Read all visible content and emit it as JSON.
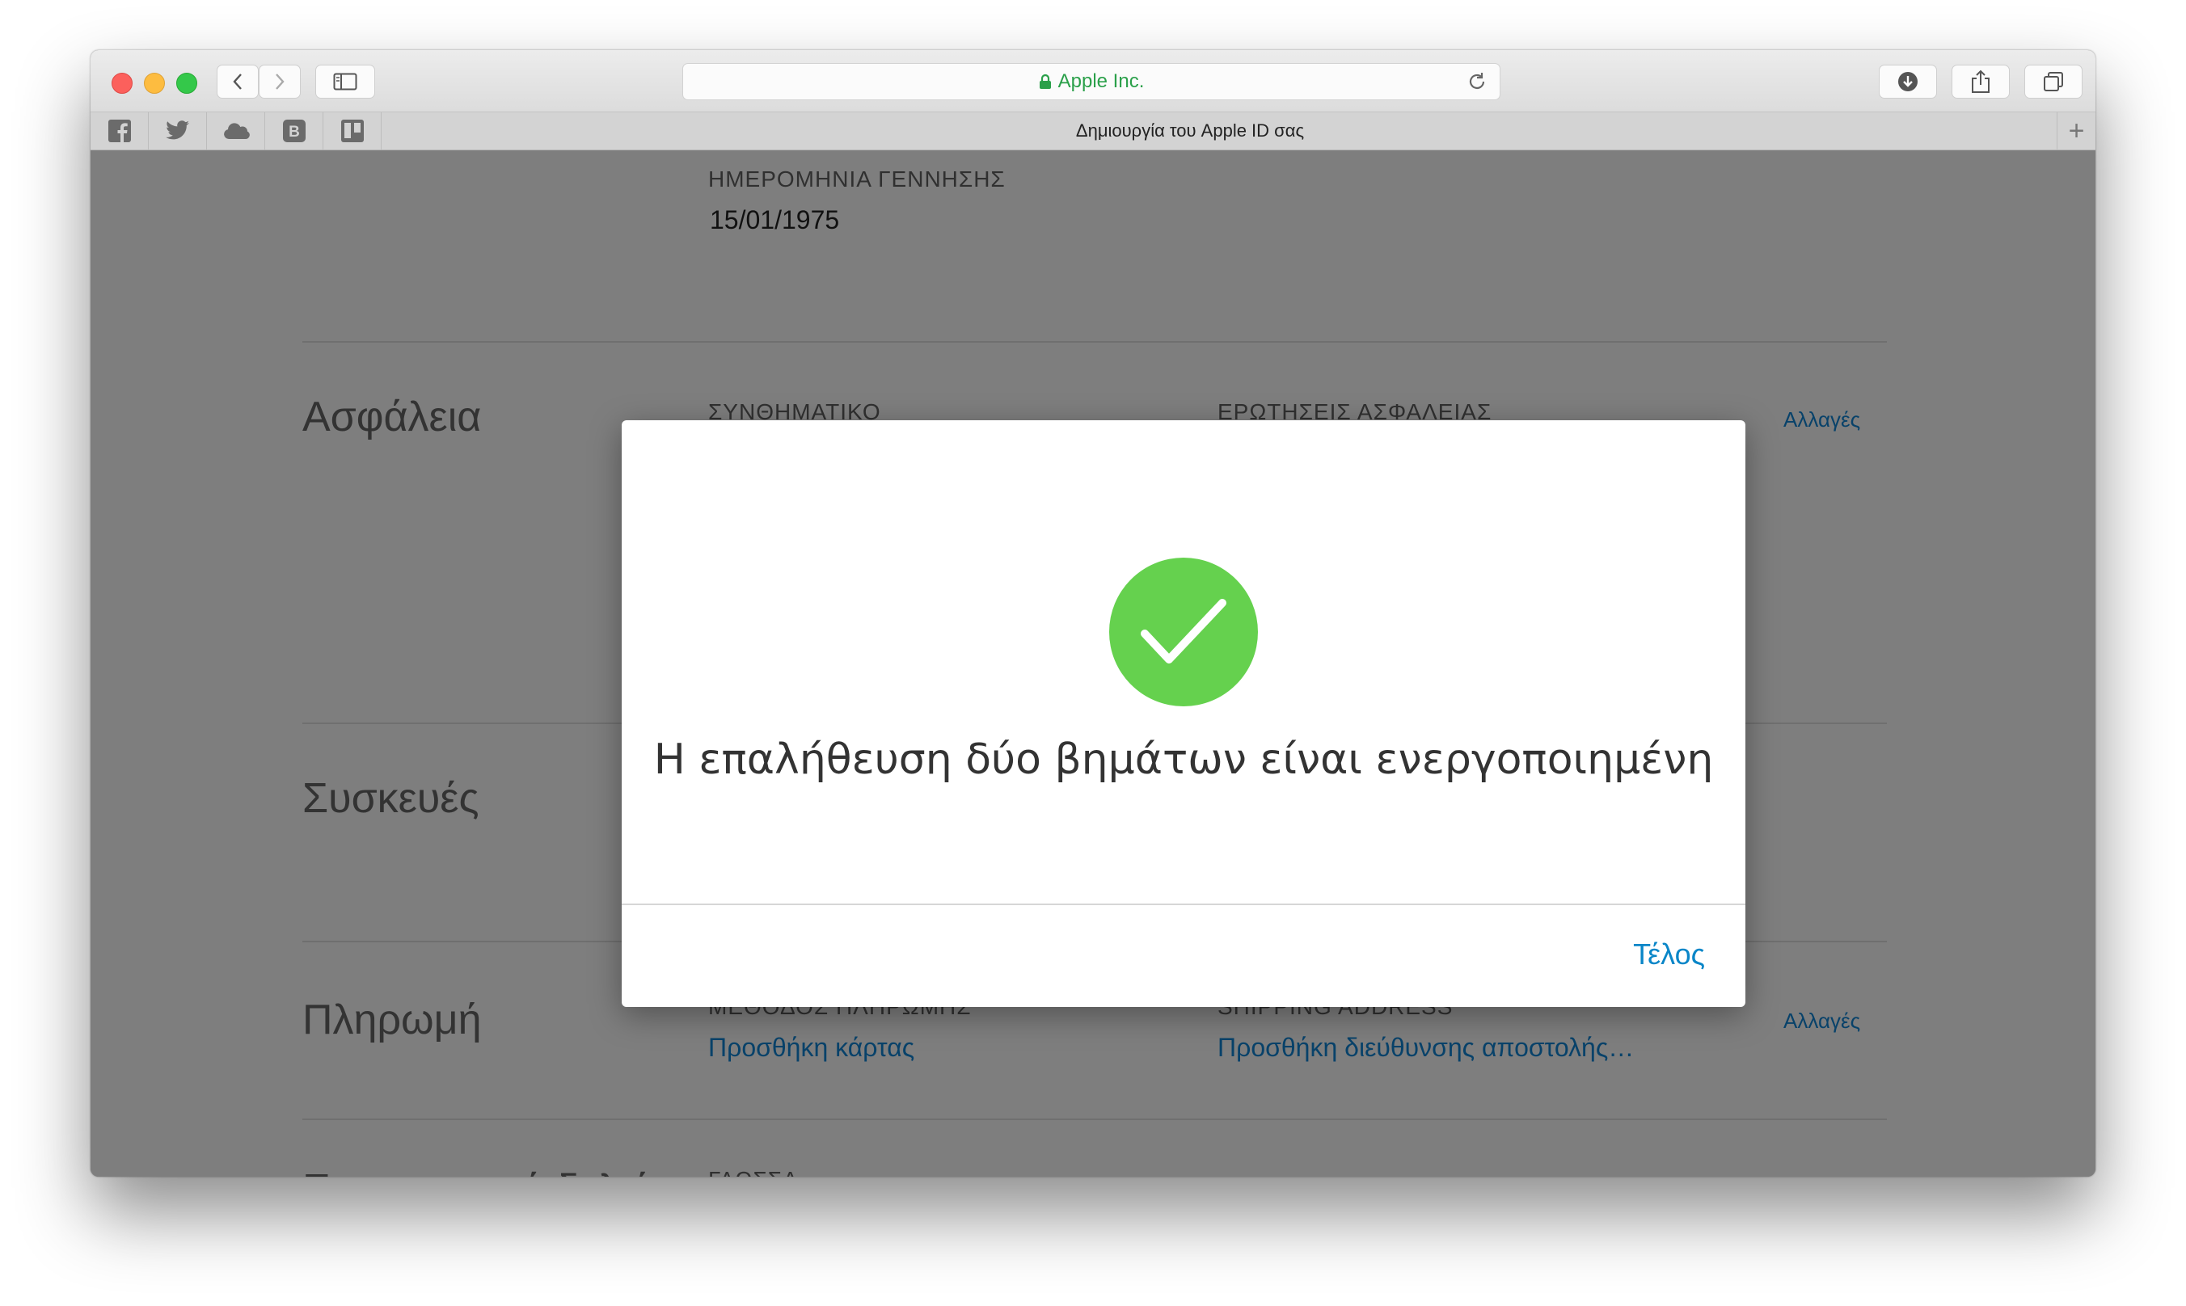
{
  "browser": {
    "address_text": "Apple Inc.",
    "tab_title": "Δημιουργία του Apple ID σας",
    "favorites": [
      {
        "name": "facebook",
        "glyph": "f"
      },
      {
        "name": "twitter",
        "glyph": ""
      },
      {
        "name": "icloud",
        "glyph": ""
      },
      {
        "name": "b-bookmark",
        "glyph": "B"
      },
      {
        "name": "trello",
        "glyph": ""
      }
    ],
    "new_tab_label": "+"
  },
  "page": {
    "birthdate_label": "ΗΜΕΡΟΜΗΝΙΑ ΓΕΝΝΗΣΗΣ",
    "birthdate_value": "15/01/1975",
    "security": {
      "title": "Ασφάλεια",
      "password_label": "ΣΥΝΘΗΜΑΤΙΚΟ",
      "questions_label": "ΕΡΩΤΗΣΕΙΣ ΑΣΦΑΛΕΙΑΣ",
      "edit_link": "Αλλαγές"
    },
    "devices": {
      "title": "Συσκευές"
    },
    "payment": {
      "title": "Πληρωμή",
      "method_label": "ΜΕΘΟΔΟΣ ΠΛΗΡΩΜΗΣ",
      "shipping_label": "SHIPPING ADDRESS",
      "add_card_link": "Προσθήκη κάρτας",
      "add_shipping_link": "Προσθήκη διεύθυνσης αποστολής…",
      "edit_link": "Αλλαγές"
    },
    "newsletters": {
      "title": "Ενημερωτικά δελτία",
      "language_label": "ΓΛΩΣΣΑ"
    }
  },
  "modal": {
    "message": "Η επαλήθευση δύο βημάτων είναι ενεργοποιημένη",
    "done_button": "Τέλος"
  },
  "colors": {
    "success_green": "#65d14e",
    "link_blue": "#0a86c8",
    "overlay_gray": "#7e7e7e"
  }
}
